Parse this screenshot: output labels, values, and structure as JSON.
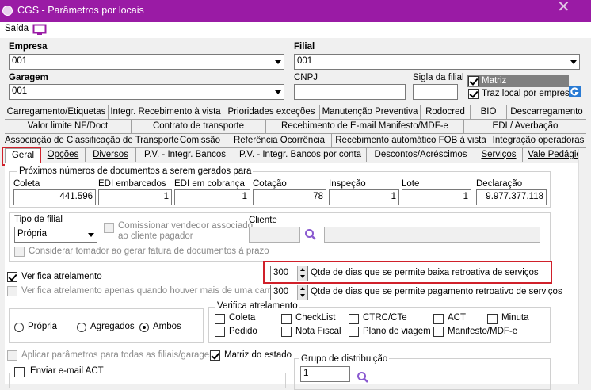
{
  "window": {
    "title": "CGS - Parâmetros por locais",
    "close": "✕"
  },
  "menu": {
    "exit": "Saída"
  },
  "company": {
    "label": "Empresa",
    "value": "001"
  },
  "branch": {
    "label": "Filial",
    "value": "001"
  },
  "garage": {
    "label": "Garagem",
    "value": "001"
  },
  "cnpj": {
    "label": "CNPJ",
    "value": ""
  },
  "branch_acronym": {
    "label": "Sigla da filial",
    "value": ""
  },
  "matriz": {
    "label": "Matriz",
    "checked": true
  },
  "local_per_company": {
    "label": "Traz local por empresa",
    "checked": true
  },
  "tabs_row1": [
    "Carregamento/Etiquetas",
    "Integr. Recebimento à vista",
    "Prioridades exceções",
    "Manutenção Preventiva",
    "Rodocred",
    "BIO",
    "Descarregamento"
  ],
  "tabs_row2": [
    "Valor limite NF/Doct",
    "Contrato de transporte",
    "Recebimento de E-mail Manifesto/MDF-e",
    "EDI / Averbação"
  ],
  "tabs_row3": [
    "Associação de Classificação de Transporte",
    "Comissão",
    "Referência Ocorrência",
    "Recebimento automático FOB à vista",
    "Integração operadoras"
  ],
  "tabs_row4": [
    "Geral",
    "Opções",
    "Diversos",
    "P.V. - Integr. Bancos",
    "P.V. - Integr. Bancos por conta",
    "Descontos/Acréscimos",
    "Serviços",
    "Vale Pedágio"
  ],
  "next_docs": {
    "title": "Próximos números de documentos a serem gerados para",
    "fields": [
      {
        "label": "Coleta",
        "value": "441.596"
      },
      {
        "label": "EDI embarcados",
        "value": "1"
      },
      {
        "label": "EDI em cobrança",
        "value": "1"
      },
      {
        "label": "Cotação",
        "value": "78"
      },
      {
        "label": "Inspeção",
        "value": "1"
      },
      {
        "label": "Lote",
        "value": "1"
      },
      {
        "label": "Declaração",
        "value": "9.977.377.118"
      }
    ]
  },
  "branch_type": {
    "label": "Tipo de filial",
    "value": "Própria"
  },
  "commission": {
    "label": "Comissionar vendedor associado ao cliente pagador",
    "line1": "Comissionar vendedor associado",
    "line2": "ao cliente pagador"
  },
  "client": {
    "label": "Cliente",
    "code": "",
    "name": ""
  },
  "consider_taker": {
    "label": "Considerar tomador ao gerar fatura de documentos à prazo"
  },
  "check_coupling": {
    "label": "Verifica atrelamento",
    "checked": true
  },
  "check_coupling_cart": {
    "label": "Verifica atrelamento apenas quando houver mais de uma carreta"
  },
  "days_retro_low": {
    "value": "300",
    "label": "Qtde de dias que se permite baixa retroativa de serviços"
  },
  "days_retro_pay": {
    "value": "300",
    "label": "Qtde de dias que se permite pagamento retroativo de serviços"
  },
  "ownership": {
    "options": [
      "Própria",
      "Agregados",
      "Ambos"
    ],
    "selected": "Ambos"
  },
  "coupling_group": {
    "title": "Verifica atrelamento",
    "items": [
      "Coleta",
      "CheckList",
      "CTRC/CTe",
      "ACT",
      "Minuta",
      "Pedido",
      "Nota Fiscal",
      "Plano de viagem",
      "Manifesto/MDF-e"
    ]
  },
  "apply_all": {
    "label": "Aplicar parâmetros para todas as filiais/garagens"
  },
  "matriz_state": {
    "label": "Matriz do estado",
    "checked": true
  },
  "distribution_group": {
    "label": "Grupo de distribuição",
    "value": "1"
  },
  "send_email_act": {
    "label": "Enviar e-mail ACT"
  }
}
